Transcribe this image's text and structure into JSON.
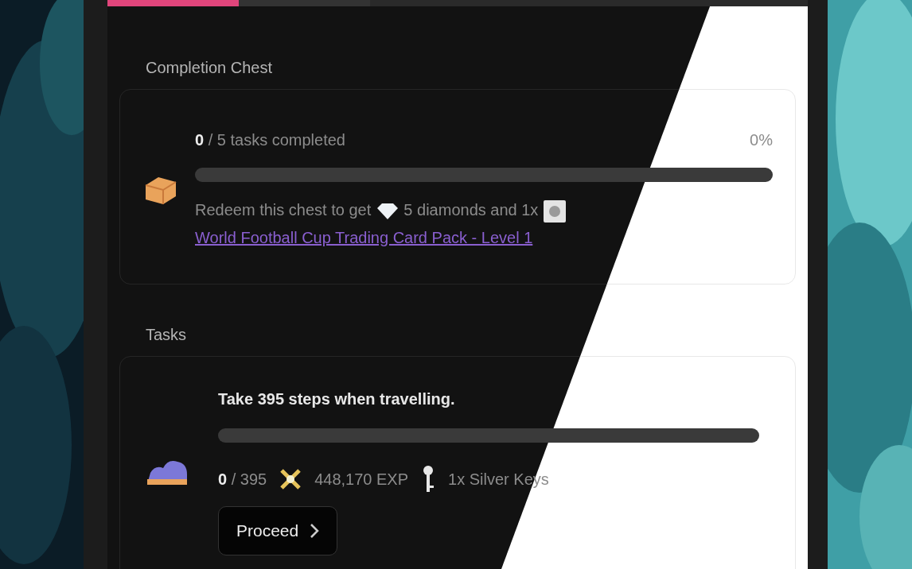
{
  "tabs": [
    {
      "selected": true
    },
    {
      "selected": false
    }
  ],
  "completion_chest": {
    "title": "Completion Chest",
    "progress_text": "**0** / 5 tasks completed",
    "percent": "0%",
    "level": 0,
    "reward_prefix": "Redeem this chest to get",
    "diamonds": "5 diamonds and 1x",
    "reward_link": "World Football Cup Trading Card Pack - Level 1"
  },
  "tasks": {
    "title": "Tasks",
    "items": [
      {
        "description": "Take 395 steps when travelling.",
        "level": 0,
        "progress": "**0** / 395",
        "exp": "448,170 EXP",
        "keys": "1x Silver Keys",
        "button": "Proceed"
      }
    ]
  }
}
